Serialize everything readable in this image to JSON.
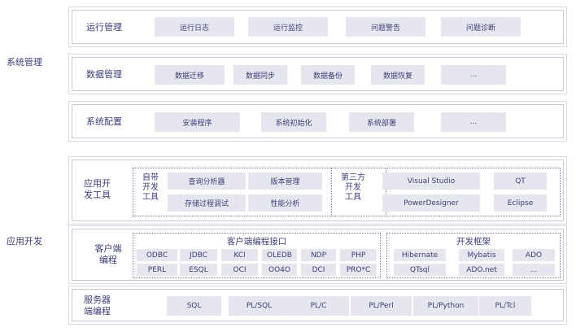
{
  "groups": {
    "system": "系统管理",
    "app": "应用开发"
  },
  "ops": {
    "title": "运行管理",
    "items": [
      "运行日志",
      "运行监控",
      "问题警告",
      "问题诊断"
    ]
  },
  "data_mgmt": {
    "title": "数据管理",
    "items": [
      "数据迁移",
      "数据同步",
      "数据备份",
      "数据恢复",
      "..."
    ]
  },
  "config": {
    "title": "系统配置",
    "items": [
      "安装程序",
      "系统初始化",
      "系统部署",
      "..."
    ]
  },
  "dev_tools": {
    "title_lines": [
      "应用开",
      "发工具"
    ],
    "builtin": {
      "label_lines": [
        "自带",
        "开发",
        "工具"
      ],
      "items": [
        "查询分析器",
        "版本管理",
        "存储过程调试",
        "性能分析"
      ]
    },
    "third_party": {
      "label_lines": [
        "第三方",
        "开发",
        "工具"
      ],
      "items": [
        "Visual  Studio",
        "QT",
        "PowerDesigner",
        "Eclipse"
      ]
    }
  },
  "client": {
    "title_lines": [
      "客户端",
      "编程"
    ],
    "interfaces": {
      "title": "客户端编程接口",
      "row1": [
        "ODBC",
        "JDBC",
        "KCI",
        "OLEDB",
        "NDP",
        "PHP"
      ],
      "row2": [
        "PERL",
        "ESQL",
        "OCI",
        "OO4O",
        "DCI",
        "PRO*C"
      ]
    },
    "frameworks": {
      "title": "开发框架",
      "row1": [
        "Hibernate",
        "Mybatis",
        "ADO"
      ],
      "row2": [
        "QTsql",
        "ADO.net",
        "..."
      ]
    }
  },
  "server": {
    "title_lines": [
      "服务器",
      "端编程"
    ],
    "items": [
      "SQL",
      "PL/SQL",
      "PL/C",
      "PL/Perl",
      "PL/Python",
      "PL/Tcl"
    ]
  }
}
